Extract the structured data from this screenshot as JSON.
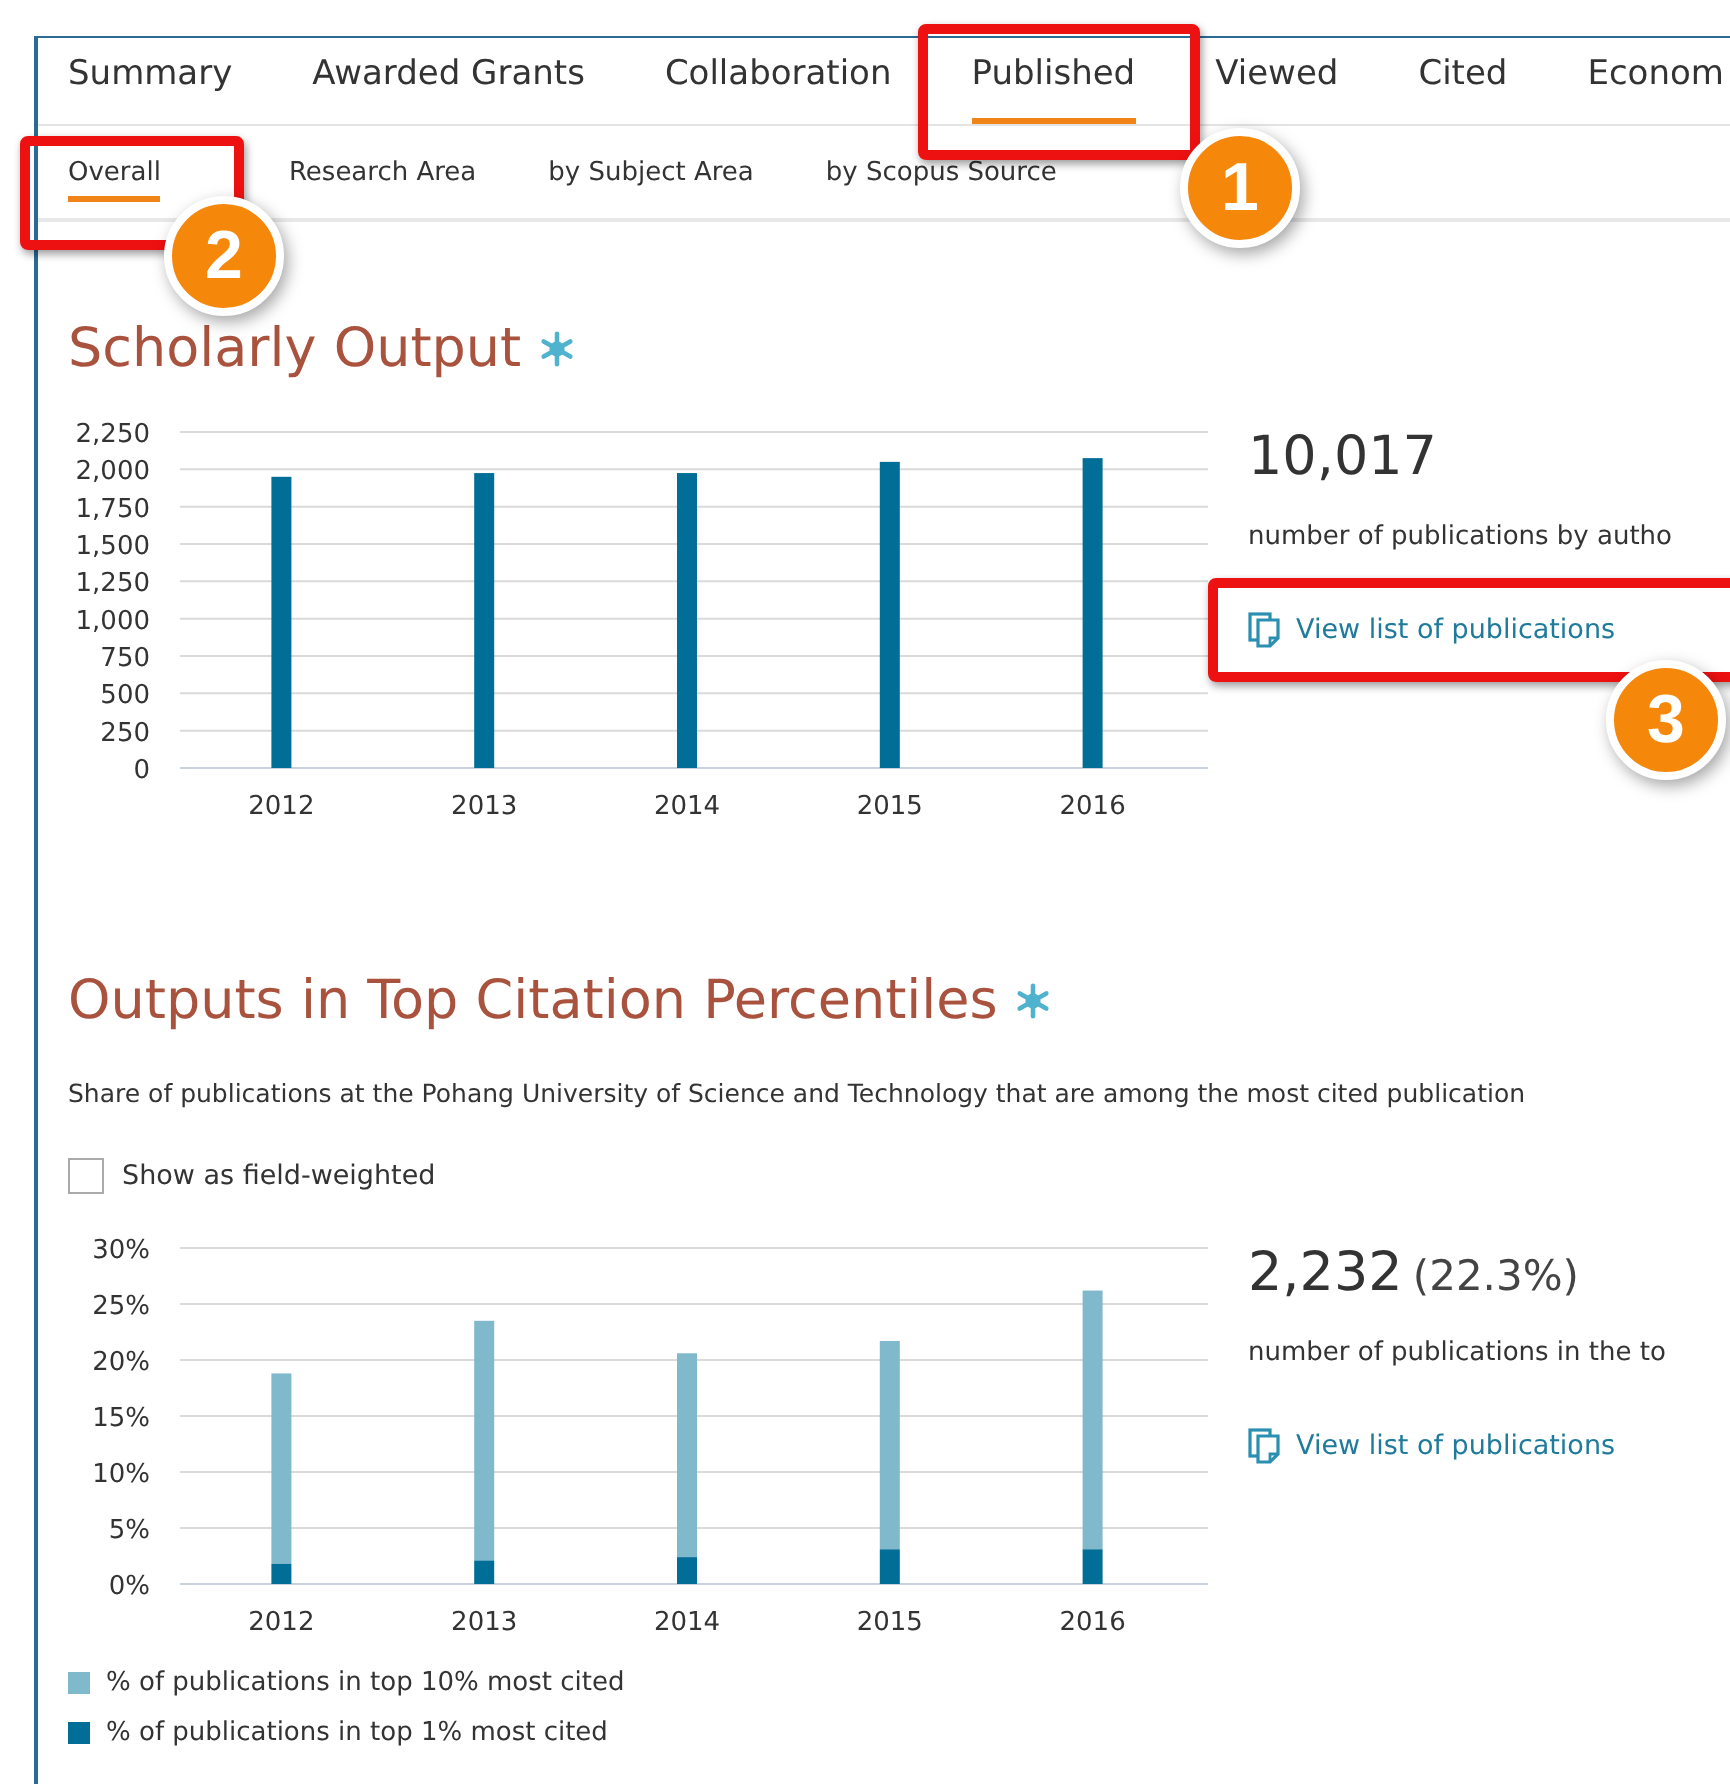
{
  "tabs": [
    {
      "label": "Summary",
      "selected": false
    },
    {
      "label": "Awarded Grants",
      "selected": false
    },
    {
      "label": "Collaboration",
      "selected": false
    },
    {
      "label": "Published",
      "selected": true
    },
    {
      "label": "Viewed",
      "selected": false
    },
    {
      "label": "Cited",
      "selected": false
    },
    {
      "label": "Econom",
      "selected": false
    }
  ],
  "subtabs": [
    {
      "label": "Overall",
      "selected": true
    },
    {
      "label": "Research Area",
      "selected": false
    },
    {
      "label": "by Subject Area",
      "selected": false
    },
    {
      "label": "by Scopus Source",
      "selected": false
    }
  ],
  "sections": [
    {
      "title": "Scholarly Output",
      "chart_data": {
        "type": "bar",
        "categories": [
          "2012",
          "2013",
          "2014",
          "2015",
          "2016"
        ],
        "values": [
          1950,
          1975,
          1975,
          2050,
          2075
        ],
        "grid": true,
        "ylim": [
          0,
          2250
        ],
        "yticks": [
          {
            "value": 0,
            "label": "0"
          },
          {
            "value": 250,
            "label": "250"
          },
          {
            "value": 500,
            "label": "500"
          },
          {
            "value": 750,
            "label": "750"
          },
          {
            "value": 1000,
            "label": "1,000"
          },
          {
            "value": 1250,
            "label": "1,250"
          },
          {
            "value": 1500,
            "label": "1,500"
          },
          {
            "value": 1750,
            "label": "1,750"
          },
          {
            "value": 2000,
            "label": "2,000"
          },
          {
            "value": 2250,
            "label": "2,250"
          }
        ]
      },
      "metric": {
        "value": "10,017",
        "description": "number of publications by autho",
        "link": "View list of publications"
      }
    },
    {
      "title": "Outputs in Top Citation Percentiles",
      "description": "Share of publications at the Pohang University of Science and Technology that are among the most cited publication",
      "checkbox": {
        "label": "Show as field-weighted",
        "checked": false
      },
      "chart_data": {
        "type": "bar",
        "categories": [
          "2012",
          "2013",
          "2014",
          "2015",
          "2016"
        ],
        "stacked": true,
        "grid": true,
        "series": [
          {
            "name": "% of publications in top 10% most cited",
            "color": "#80b8cc",
            "values": [
              17.0,
              21.4,
              18.2,
              18.6,
              23.1
            ]
          },
          {
            "name": "% of publications in top 1% most cited",
            "color": "#006e96",
            "values": [
              1.8,
              2.1,
              2.4,
              3.1,
              3.1
            ]
          }
        ],
        "ylim": [
          0,
          30
        ],
        "yticks": [
          {
            "value": 0,
            "label": "0%"
          },
          {
            "value": 5,
            "label": "5%"
          },
          {
            "value": 10,
            "label": "10%"
          },
          {
            "value": 15,
            "label": "15%"
          },
          {
            "value": 20,
            "label": "20%"
          },
          {
            "value": 25,
            "label": "25%"
          },
          {
            "value": 30,
            "label": "30%"
          }
        ]
      },
      "metric": {
        "value": "2,232",
        "extra": "(22.3%)",
        "description": "number of publications in the to",
        "link": "View list of publications"
      }
    }
  ],
  "callouts": [
    "1",
    "2",
    "3"
  ]
}
